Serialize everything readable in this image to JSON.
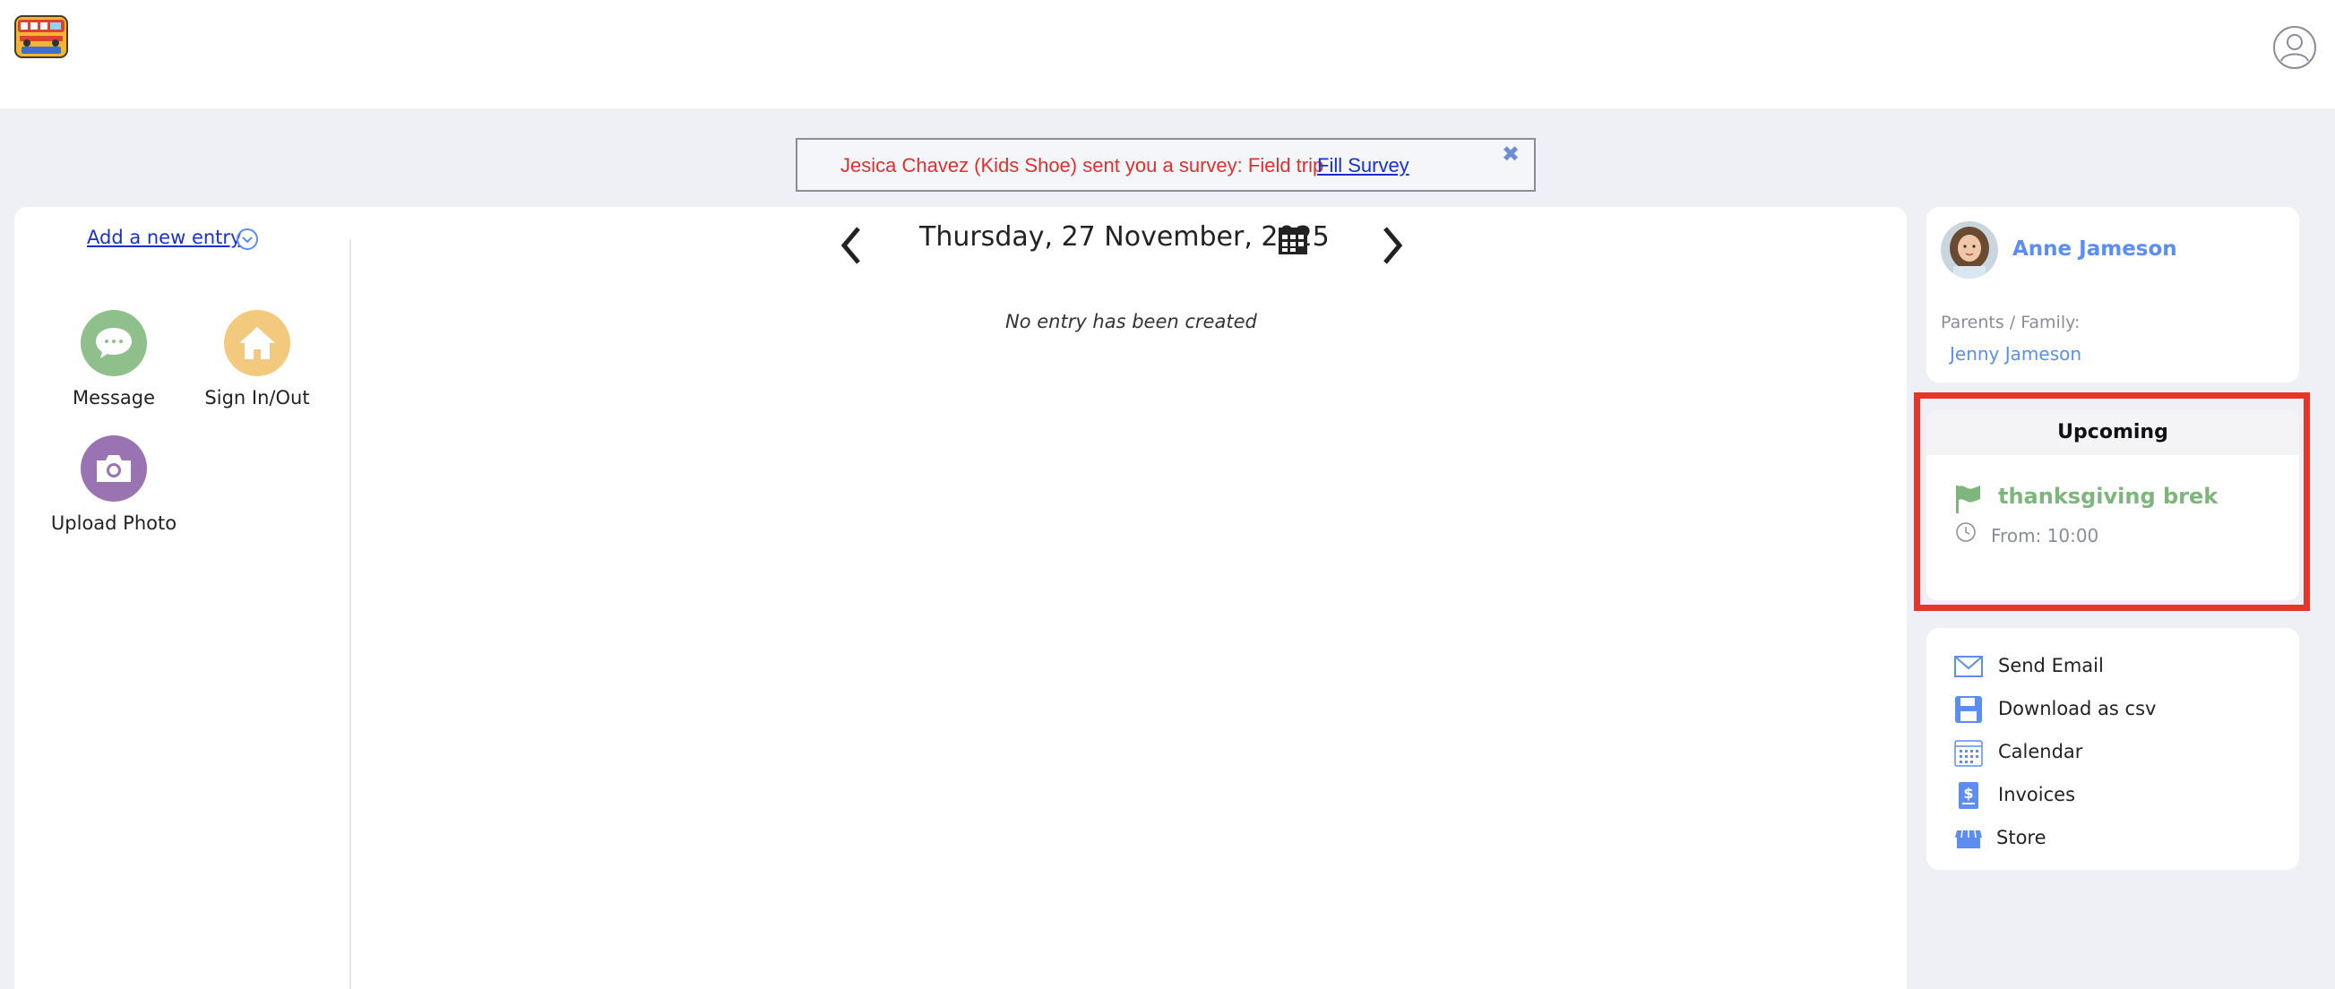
{
  "notice": {
    "text": "Jesica Chavez (Kids Shoe) sent you a survey: Field trip",
    "link": "Fill Survey",
    "close_icon": "close-icon"
  },
  "left": {
    "add_entry": "Add a new entry",
    "actions": [
      {
        "label": "Message",
        "icon": "message-icon",
        "color": "#8fbf8a"
      },
      {
        "label": "Sign In/Out",
        "icon": "house-icon",
        "color": "#f3c97e"
      },
      {
        "label": "Upload Photo",
        "icon": "camera-icon",
        "color": "#9a74b2"
      }
    ]
  },
  "journal": {
    "date": "Thursday, 27 November, 2025",
    "empty": "No entry has been created"
  },
  "profile": {
    "name": "Anne Jameson",
    "family_label": "Parents / Family:",
    "family_member": "Jenny Jameson"
  },
  "upcoming": {
    "title": "Upcoming",
    "event_title": "thanksgiving brek",
    "event_time": "From: 10:00"
  },
  "menu": [
    {
      "label": "Send Email",
      "icon": "mail-icon"
    },
    {
      "label": "Download as csv",
      "icon": "save-icon"
    },
    {
      "label": "Calendar",
      "icon": "calendar-icon"
    },
    {
      "label": "Invoices",
      "icon": "invoice-icon"
    },
    {
      "label": "Store",
      "icon": "store-icon"
    }
  ],
  "colors": {
    "accent_blue": "#5b8ef0",
    "link_blue": "#1a2fd0",
    "notice_red": "#e0302e",
    "event_green": "#7db57d",
    "highlight_red": "#e4362a"
  }
}
